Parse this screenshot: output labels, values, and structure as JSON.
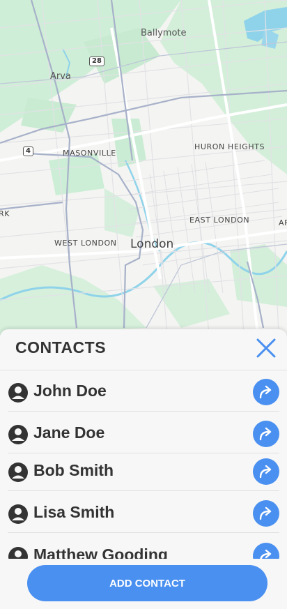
{
  "map": {
    "labels": {
      "ballymote": "Ballymote",
      "arva": "Arva",
      "masonville": "MASONVILLE",
      "huron_heights": "HURON HEIGHTS",
      "west_london": "WEST LONDON",
      "london": "London",
      "east_london": "EAST LONDON",
      "left_edge": "RK",
      "right_edge": "AR"
    },
    "route_shields": {
      "r28": "28",
      "r4": "4"
    }
  },
  "sheet": {
    "title": "CONTACTS",
    "close_icon": "close-icon",
    "contacts": [
      {
        "name": "John Doe"
      },
      {
        "name": "Jane Doe"
      },
      {
        "name": "Bob Smith"
      },
      {
        "name": "Lisa Smith"
      },
      {
        "name": "Matthew Gooding"
      }
    ],
    "add_button_label": "ADD CONTACT"
  },
  "colors": {
    "accent": "#4a90f0",
    "text": "#333333",
    "park": "#cdeed6",
    "water": "#8fd3ea"
  }
}
